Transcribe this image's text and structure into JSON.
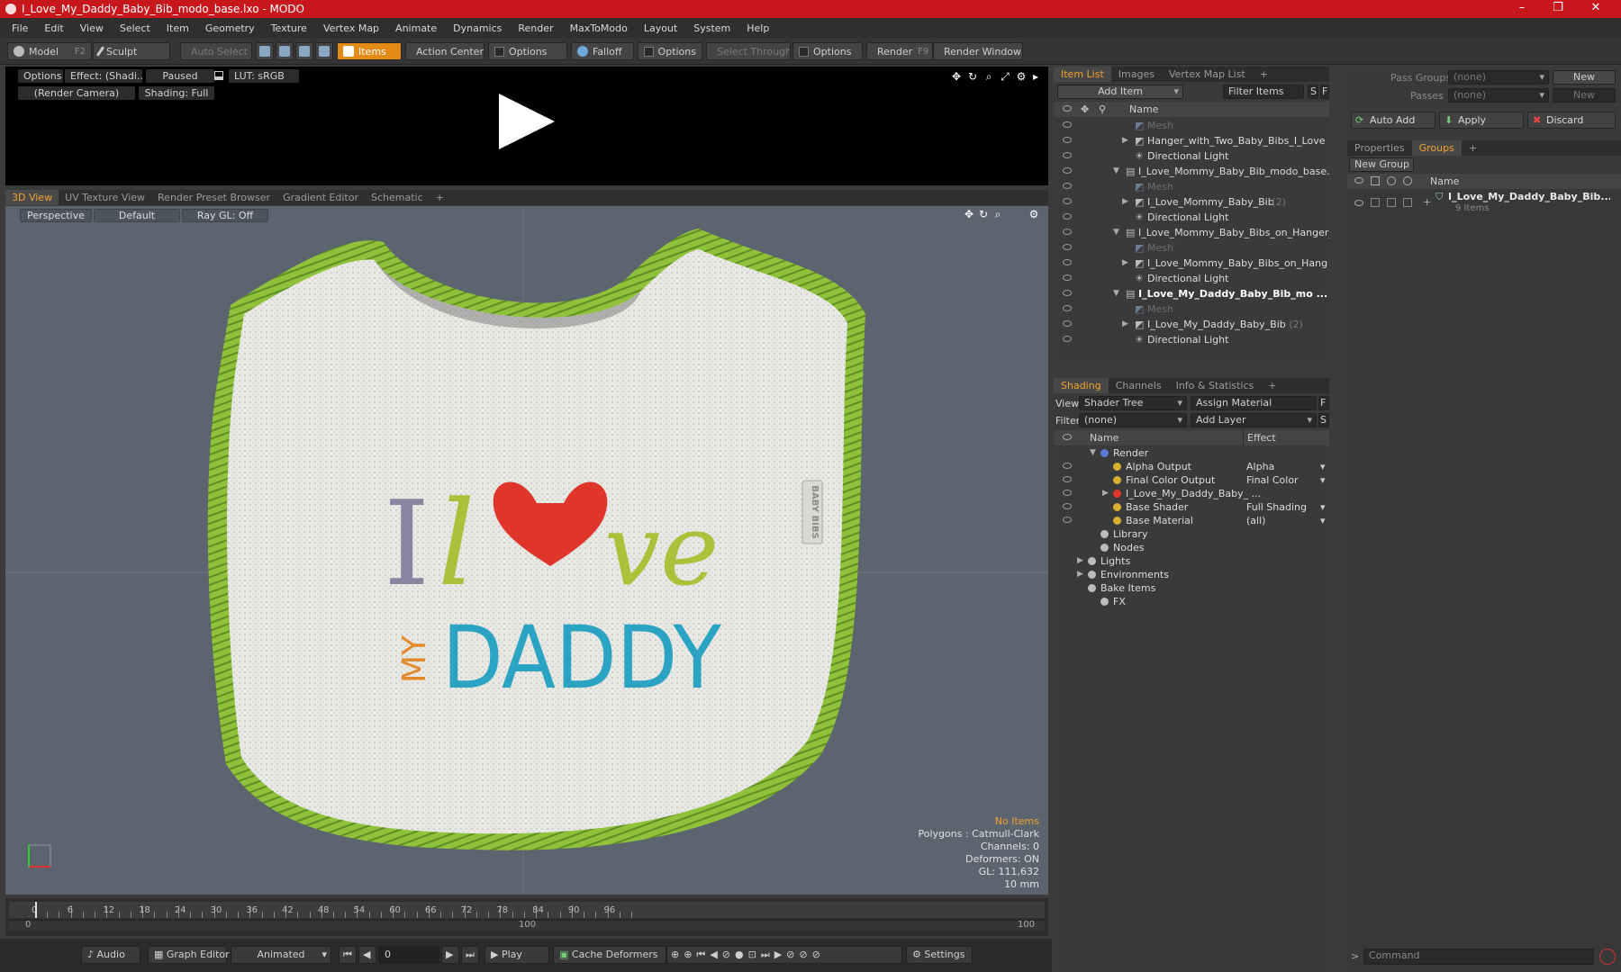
{
  "window": {
    "title": "I_Love_My_Daddy_Baby_Bib_modo_base.lxo - MODO"
  },
  "menu": [
    "File",
    "Edit",
    "View",
    "Select",
    "Item",
    "Geometry",
    "Texture",
    "Vertex Map",
    "Animate",
    "Dynamics",
    "Render",
    "MaxToModo",
    "Layout",
    "System",
    "Help"
  ],
  "toolbar": {
    "model": "Model",
    "model_key": "F2",
    "sculpt": "Sculpt",
    "auto_select": "Auto Select",
    "items": "Items",
    "action_center": "Action Center",
    "options1": "Options",
    "falloff": "Falloff",
    "options2": "Options",
    "select_through": "Select Through",
    "options3": "Options",
    "render": "Render",
    "render_key": "F9",
    "render_window": "Render Window"
  },
  "render_preview": {
    "options": "Options",
    "effect": "Effect: (Shadi...",
    "paused": "Paused",
    "lut": "LUT: sRGB",
    "camera": "(Render Camera)",
    "shading": "Shading: Full"
  },
  "viewport_tabs": [
    "3D View",
    "UV Texture View",
    "Render Preset Browser",
    "Gradient Editor",
    "Schematic",
    "+"
  ],
  "viewport": {
    "perspective": "Perspective",
    "default": "Default",
    "raygl": "Ray GL: Off",
    "info": {
      "no_items": "No Items",
      "polygons": "Polygons : Catmull-Clark",
      "channels": "Channels: 0",
      "deformers": "Deformers: ON",
      "gl": "GL: 111,632",
      "scale": "10 mm"
    },
    "bib_text": {
      "i": "I",
      "l": "l",
      "ve": "ve",
      "my": "MY",
      "daddy": "DADDY",
      "tag": "BABY BIBS"
    }
  },
  "timeline": {
    "ticks": [
      "0",
      "6",
      "12",
      "18",
      "24",
      "30",
      "36",
      "42",
      "48",
      "54",
      "60",
      "66",
      "72",
      "78",
      "84",
      "90",
      "96"
    ],
    "lower": {
      "start": "0",
      "mid": "100",
      "end": "100"
    },
    "current_frame": 0
  },
  "bottombar": {
    "audio": "Audio",
    "graph_editor": "Graph Editor",
    "animated": "Animated",
    "frame": "0",
    "play": "Play",
    "cache_deformers": "Cache Deformers",
    "settings": "Settings"
  },
  "item_list": {
    "tabs": [
      "Item List",
      "Images",
      "Vertex Map List",
      "+"
    ],
    "add_item": "Add Item",
    "filter_items": "Filter Items",
    "btn_s": "S",
    "btn_f": "F",
    "col_name": "Name",
    "rows": [
      {
        "label": "Mesh",
        "indent": 2,
        "dim": true
      },
      {
        "label": "Hanger_with_Two_Baby_Bibs_I_Love ...",
        "indent": 2,
        "dim": false,
        "arrow": "▶"
      },
      {
        "label": "Directional Light",
        "indent": 2,
        "dim": false
      },
      {
        "label": "I_Love_Mommy_Baby_Bib_modo_base.lxo",
        "indent": 1,
        "dim": false,
        "arrow": "▼"
      },
      {
        "label": "Mesh",
        "indent": 2,
        "dim": true
      },
      {
        "label": "I_Love_Mommy_Baby_Bib",
        "suffix": "(2)",
        "indent": 2,
        "dim": false,
        "arrow": "▶"
      },
      {
        "label": "Directional Light",
        "indent": 2,
        "dim": false
      },
      {
        "label": "I_Love_Mommy_Baby_Bibs_on_Hanger_...",
        "indent": 1,
        "dim": false,
        "arrow": "▼"
      },
      {
        "label": "Mesh",
        "indent": 2,
        "dim": true
      },
      {
        "label": "I_Love_Mommy_Baby_Bibs_on_Hang ...",
        "indent": 2,
        "dim": false,
        "arrow": "▶"
      },
      {
        "label": "Directional Light",
        "indent": 2,
        "dim": false
      },
      {
        "label": "I_Love_My_Daddy_Baby_Bib_mo ...",
        "indent": 1,
        "dim": false,
        "arrow": "▼",
        "bold": true
      },
      {
        "label": "Mesh",
        "indent": 2,
        "dim": true
      },
      {
        "label": "I_Love_My_Daddy_Baby_Bib",
        "suffix": "(2)",
        "indent": 2,
        "dim": false,
        "arrow": "▶"
      },
      {
        "label": "Directional Light",
        "indent": 2,
        "dim": false
      }
    ]
  },
  "shading": {
    "tabs": [
      "Shading",
      "Channels",
      "Info & Statistics",
      "+"
    ],
    "view_label": "View",
    "view_value": "Shader Tree",
    "assign_material": "Assign Material",
    "filter_label": "Filter",
    "filter_value": "(none)",
    "add_layer": "Add Layer",
    "btn_f": "F",
    "btn_s": "S",
    "col_name": "Name",
    "col_effect": "Effect",
    "rows": [
      {
        "label": "Render",
        "effect": "",
        "indent": 1,
        "arrow": "▼",
        "eye": false
      },
      {
        "label": "Alpha Output",
        "effect": "Alpha",
        "indent": 2,
        "eye": true
      },
      {
        "label": "Final Color Output",
        "effect": "Final Color",
        "indent": 2,
        "eye": true
      },
      {
        "label": "I_Love_My_Daddy_Baby_ ...",
        "effect": "",
        "indent": 2,
        "arrow": "▶",
        "eye": true
      },
      {
        "label": "Base Shader",
        "effect": "Full Shading",
        "indent": 2,
        "eye": true
      },
      {
        "label": "Base Material",
        "effect": "(all)",
        "indent": 2,
        "eye": true
      },
      {
        "label": "Library",
        "effect": "",
        "indent": 1,
        "eye": false
      },
      {
        "label": "Nodes",
        "effect": "",
        "indent": 1,
        "eye": false
      },
      {
        "label": "Lights",
        "effect": "",
        "indent": 0,
        "arrow": "▶",
        "eye": false
      },
      {
        "label": "Environments",
        "effect": "",
        "indent": 0,
        "arrow": "▶",
        "eye": false
      },
      {
        "label": "Bake Items",
        "effect": "",
        "indent": 0,
        "eye": false
      },
      {
        "label": "FX",
        "effect": "",
        "indent": 1,
        "eye": false
      }
    ]
  },
  "groups_panel": {
    "pass_groups_label": "Pass Groups",
    "pass_groups_value": "(none)",
    "passes_label": "Passes",
    "passes_value": "(none)",
    "new": "New",
    "new2": "New",
    "auto_add": "Auto Add",
    "apply": "Apply",
    "discard": "Discard",
    "tabs": [
      "Properties",
      "Groups",
      "+"
    ],
    "new_group": "New Group",
    "col_name": "Name",
    "group_name": "I_Love_My_Daddy_Baby_Bib...",
    "group_items": "9 Items",
    "command_placeholder": "Command"
  },
  "colors": {
    "accent": "#f0a030",
    "title_bar": "#c8161d",
    "bib_trim": "#8fc23a"
  }
}
